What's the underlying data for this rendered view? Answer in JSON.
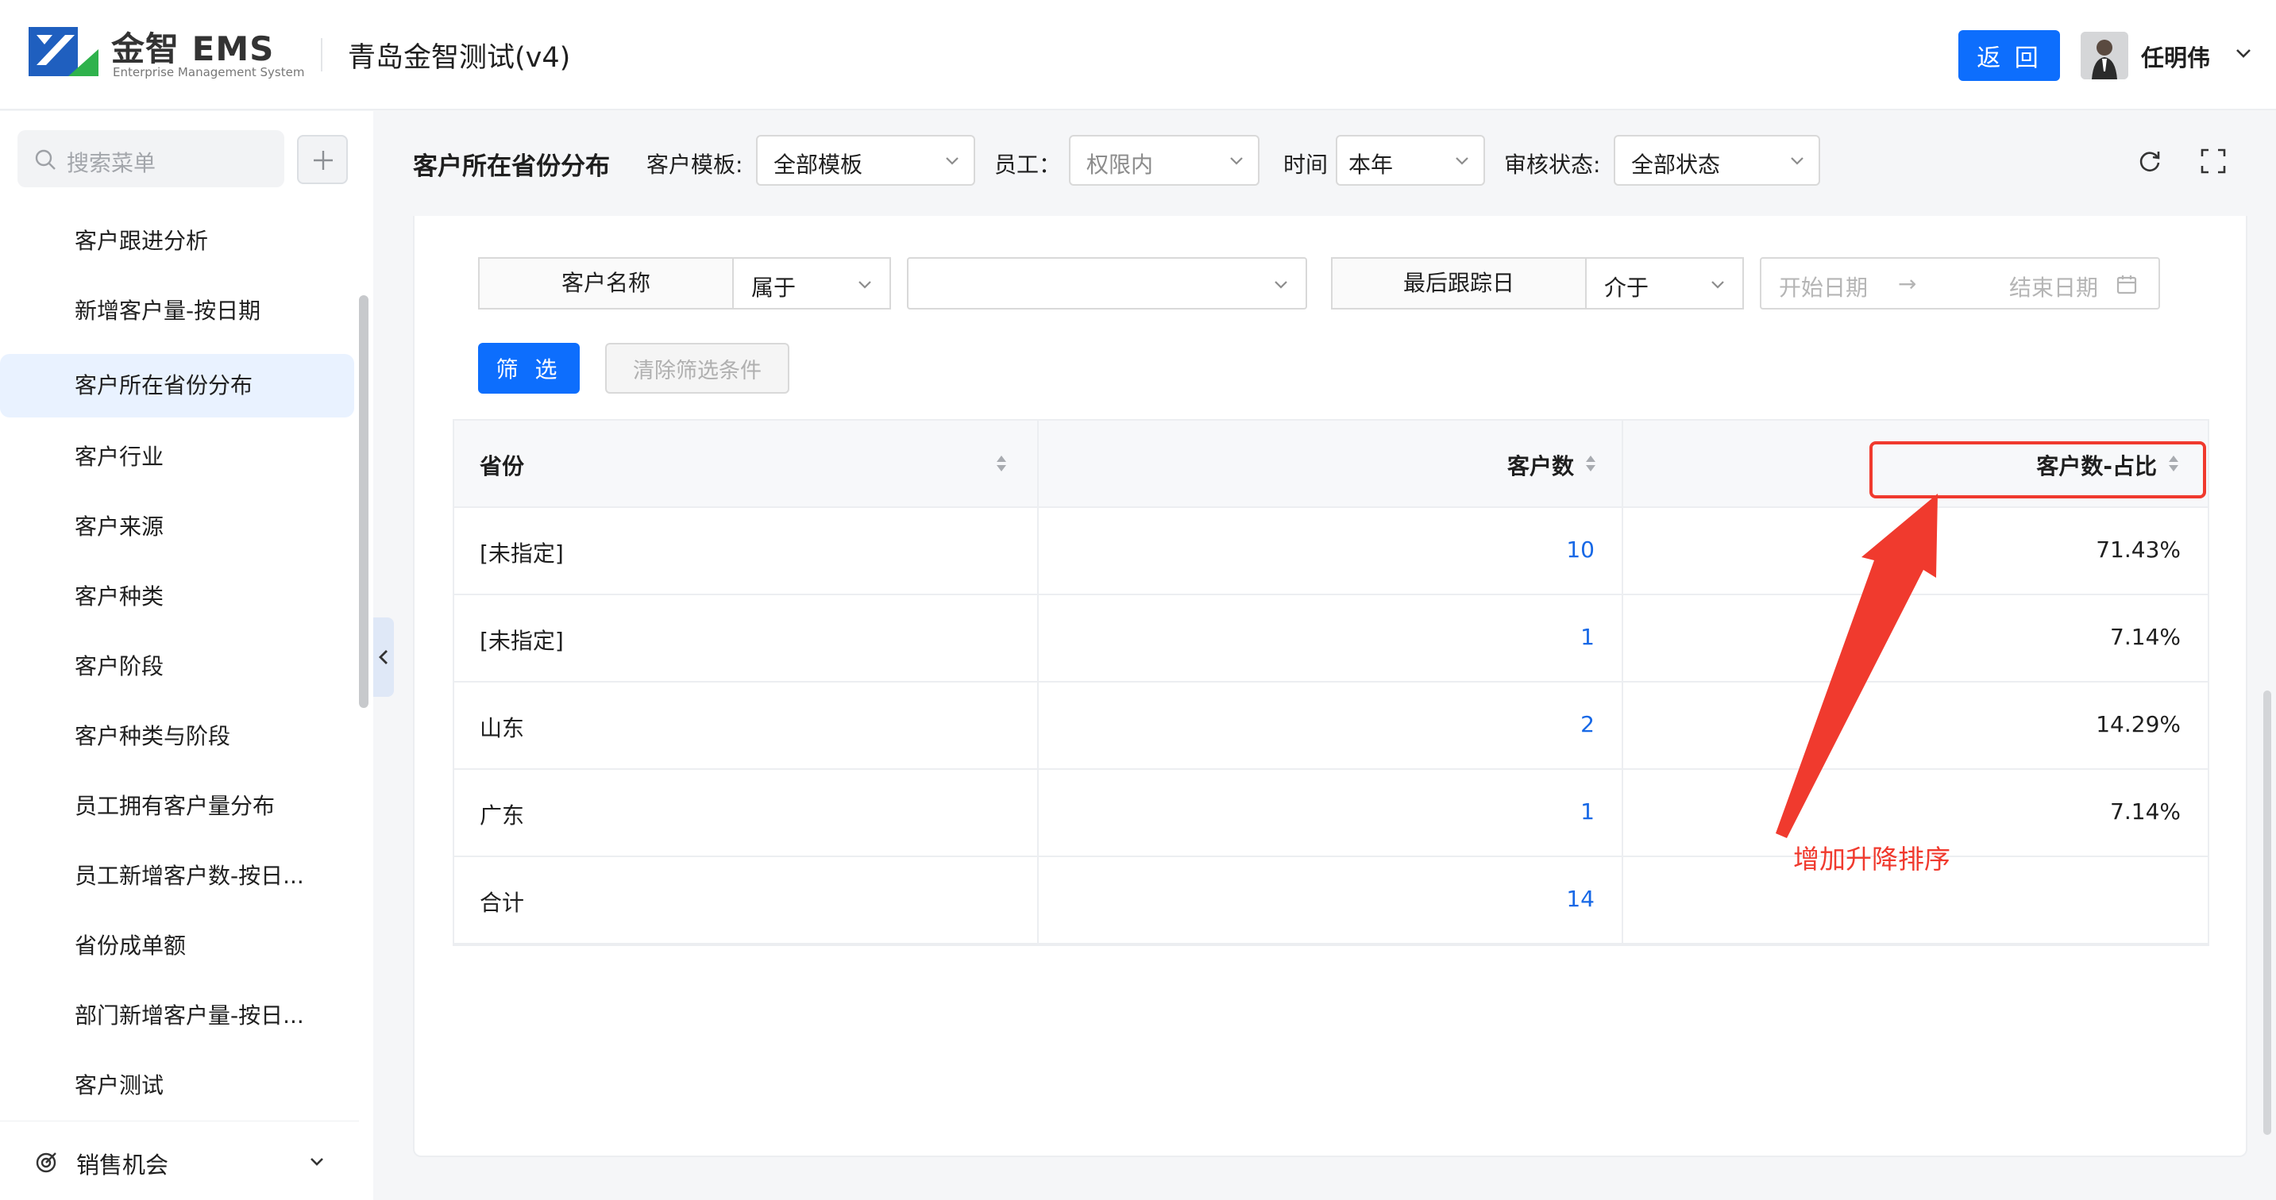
{
  "header": {
    "logo_text": "金智 EMS",
    "logo_subtitle": "Enterprise Management System",
    "company_title": "青岛金智测试(v4)",
    "back_label": "返 回",
    "user_name": "任明伟"
  },
  "sidebar": {
    "search_placeholder": "搜索菜单",
    "items": [
      {
        "label": "客户跟进分析",
        "active": false
      },
      {
        "label": "新增客户量-按日期",
        "active": false
      },
      {
        "label": "客户所在省份分布",
        "active": true
      },
      {
        "label": "客户行业",
        "active": false
      },
      {
        "label": "客户来源",
        "active": false
      },
      {
        "label": "客户种类",
        "active": false
      },
      {
        "label": "客户阶段",
        "active": false
      },
      {
        "label": "客户种类与阶段",
        "active": false
      },
      {
        "label": "员工拥有客户量分布",
        "active": false
      },
      {
        "label": "员工新增客户数-按日...",
        "active": false
      },
      {
        "label": "省份成单额",
        "active": false
      },
      {
        "label": "部门新增客户量-按日...",
        "active": false
      },
      {
        "label": "客户测试",
        "active": false
      }
    ],
    "group": {
      "label": "销售机会"
    }
  },
  "filterbar": {
    "title": "客户所在省份分布",
    "template": {
      "label": "客户模板:",
      "value": "全部模板"
    },
    "employee": {
      "label": "员工：",
      "value": "权限内"
    },
    "time": {
      "label": "时间",
      "value": "本年"
    },
    "audit": {
      "label": "审核状态:",
      "value": "全部状态"
    }
  },
  "conditions": {
    "name_field": "客户名称",
    "name_op": "属于",
    "name_value": "",
    "date_field": "最后跟踪日",
    "date_op": "介于",
    "start_placeholder": "开始日期",
    "arrow": "→",
    "end_placeholder": "结束日期"
  },
  "actions": {
    "filter_label": "筛 选",
    "clear_label": "清除筛选条件"
  },
  "table": {
    "columns": [
      "省份",
      "客户数",
      "客户数-占比"
    ],
    "rows": [
      {
        "province": "[未指定]",
        "count": "10",
        "ratio": "71.43%"
      },
      {
        "province": "[未指定]",
        "count": "1",
        "ratio": "7.14%"
      },
      {
        "province": "山东",
        "count": "2",
        "ratio": "14.29%"
      },
      {
        "province": "广东",
        "count": "1",
        "ratio": "7.14%"
      },
      {
        "province": "合计",
        "count": "14",
        "ratio": ""
      }
    ]
  },
  "annotation": {
    "note": "增加升降排序",
    "color": "#f03a2e"
  },
  "colors": {
    "primary": "#0d6efd",
    "link": "#1768e6",
    "active_bg": "#e9f2ff"
  }
}
